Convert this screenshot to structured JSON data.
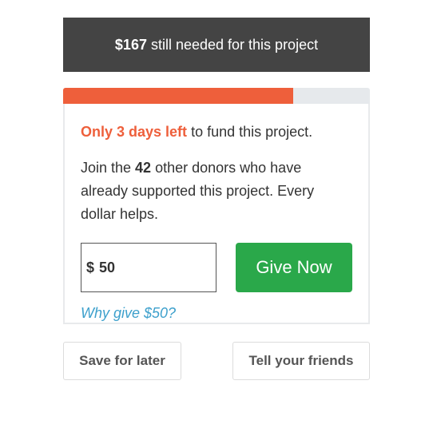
{
  "banner": {
    "amount": "$167",
    "text": "still needed for this project"
  },
  "progress": {
    "funded_fraction": 0.75
  },
  "campaign": {
    "deadline_highlight": "Only 3 days left",
    "deadline_rest": " to fund this project.",
    "donors_prefix": "Join the ",
    "donors_count": "42",
    "donors_suffix": " other donors who have already supported this project. Every dollar helps."
  },
  "donation": {
    "currency_symbol": "$",
    "amount_value": "50",
    "give_label": "Give Now",
    "why_link": "Why give $50?"
  },
  "actions": {
    "save_label": "Save for later",
    "tell_label": "Tell your friends"
  },
  "colors": {
    "banner_bg": "#444444",
    "accent_orange": "#ee5f3b",
    "give_green": "#2aa84a",
    "link_blue": "#3da0cc"
  }
}
